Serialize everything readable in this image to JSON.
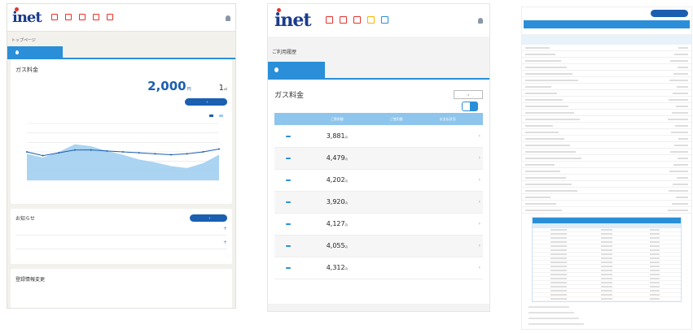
{
  "p1": {
    "brand": "inet",
    "brand_sub": "",
    "nav": [
      {
        "label": "",
        "icon": "home-icon",
        "color": "#e8322c"
      },
      {
        "label": "",
        "icon": "document-icon",
        "color": "#e8322c"
      },
      {
        "label": "",
        "icon": "chart-icon",
        "color": "#e8322c"
      },
      {
        "label": "",
        "icon": "receipt-icon",
        "color": "#e8322c"
      },
      {
        "label": "",
        "icon": "person-icon",
        "color": "#e8322c"
      }
    ],
    "user_label": "",
    "breadcrumb": "トップページ",
    "tab_label": "",
    "gas_title": "ガス料金",
    "gas_period": "",
    "gas_amount": "2,000",
    "gas_yen": "円",
    "gas_sub": "",
    "gas_usage": "1",
    "gas_usage_unit": "㎥",
    "detail_button": "",
    "legend": [
      "",
      ""
    ],
    "news_title": "お知らせ",
    "news_button": "",
    "news": [
      {
        "date": "",
        "text": ""
      },
      {
        "date": "",
        "text": ""
      }
    ],
    "reg_title": "登録情報変更",
    "reg_links": [
      "",
      "",
      "",
      ""
    ]
  },
  "chart_data": {
    "type": "area",
    "categories": [],
    "series": [
      {
        "values": [
          28,
          24,
          30,
          38,
          36,
          31,
          27,
          22,
          19,
          15,
          13,
          18,
          27
        ]
      },
      {
        "values": [
          30,
          26,
          29,
          32,
          32,
          31,
          30,
          29,
          28,
          27,
          28,
          30,
          33
        ]
      }
    ],
    "ylim": [
      0,
      60
    ],
    "colors": [
      "#9ccdf0",
      "#1b5fb0"
    ],
    "grid": true
  },
  "p2": {
    "brand": "inet",
    "nav": [
      {
        "label": "",
        "color": "#e8322c"
      },
      {
        "label": "",
        "color": "#e8322c"
      },
      {
        "label": "",
        "color": "#e8322c"
      },
      {
        "label": "",
        "color": "#f5b400"
      },
      {
        "label": "",
        "color": "#2a8fd8"
      }
    ],
    "user_label": "",
    "page_title": "ご利用履歴",
    "tab_label": "",
    "bill_title": "ガス料金",
    "filter_label": "",
    "filter_value": "",
    "range": "",
    "columns": [
      "",
      "ご請求額",
      "ご使用量",
      "お支払状況"
    ],
    "rows": [
      {
        "month": "",
        "badge": "",
        "amount": "3,881",
        "usage": "",
        "status": ""
      },
      {
        "month": "",
        "badge": "",
        "amount": "4,479",
        "usage": "",
        "status": ""
      },
      {
        "month": "",
        "badge": "",
        "amount": "4,202",
        "usage": "",
        "status": ""
      },
      {
        "month": "",
        "badge": "",
        "amount": "3,920",
        "usage": "",
        "status": ""
      },
      {
        "month": "",
        "badge": "",
        "amount": "4,127",
        "usage": "",
        "status": ""
      },
      {
        "month": "",
        "badge": "",
        "amount": "4,055",
        "usage": "",
        "status": ""
      },
      {
        "month": "",
        "badge": "",
        "amount": "4,312",
        "usage": "",
        "status": ""
      }
    ],
    "yen": "円"
  },
  "p3": {
    "top_text": "",
    "top_button": "",
    "banner": "",
    "total_label": "",
    "total_value": "",
    "sub_head": "",
    "sub_cols": [
      "",
      "",
      ""
    ]
  }
}
